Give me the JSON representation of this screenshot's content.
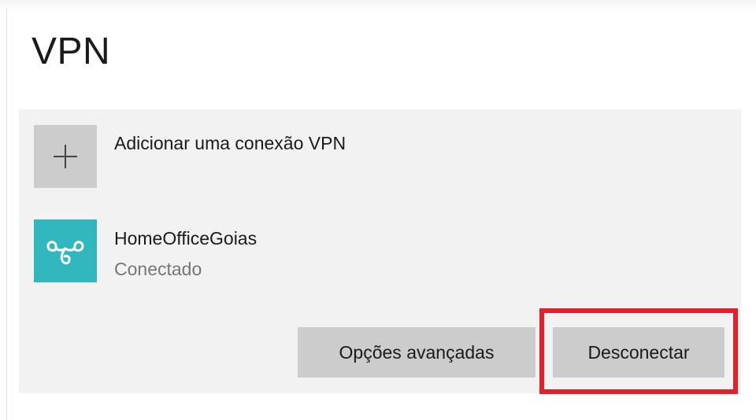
{
  "page": {
    "title": "VPN"
  },
  "add_connection": {
    "label": "Adicionar uma conexão VPN",
    "icon": "plus-icon"
  },
  "connection": {
    "name": "HomeOfficeGoias",
    "status": "Conectado",
    "icon": "vpn-link-icon",
    "tile_color": "#31b8bf"
  },
  "actions": {
    "advanced_label": "Opções avançadas",
    "disconnect_label": "Desconectar"
  },
  "annotation": {
    "highlight_color": "#e0202a",
    "highlight_target": "Desconectar"
  },
  "colors": {
    "panel_bg": "#f2f2f2",
    "button_bg": "#cccccc",
    "status_text": "#767676"
  }
}
